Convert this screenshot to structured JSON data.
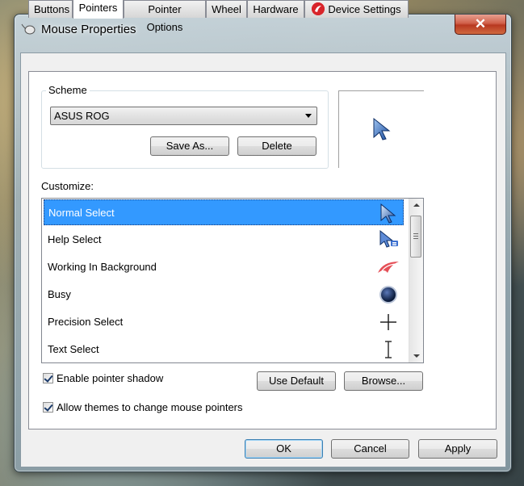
{
  "window": {
    "title": "Mouse Properties",
    "close_label": "✕"
  },
  "tabs": [
    {
      "label": "Buttons",
      "active": false
    },
    {
      "label": "Pointers",
      "active": true
    },
    {
      "label": "Pointer Options",
      "active": false
    },
    {
      "label": "Wheel",
      "active": false
    },
    {
      "label": "Hardware",
      "active": false
    },
    {
      "label": "Device Settings",
      "active": false
    }
  ],
  "scheme": {
    "group_label": "Scheme",
    "selected": "ASUS ROG",
    "save_as_label": "Save As...",
    "delete_label": "Delete"
  },
  "customize": {
    "label": "Customize:",
    "items": [
      {
        "label": "Normal Select",
        "icon": "arrow-pointer-icon",
        "selected": true
      },
      {
        "label": "Help Select",
        "icon": "help-pointer-icon",
        "selected": false
      },
      {
        "label": "Working In Background",
        "icon": "rog-logo-icon",
        "selected": false
      },
      {
        "label": "Busy",
        "icon": "busy-circle-icon",
        "selected": false
      },
      {
        "label": "Precision Select",
        "icon": "crosshair-icon",
        "selected": false
      },
      {
        "label": "Text Select",
        "icon": "ibeam-icon",
        "selected": false
      }
    ]
  },
  "options": {
    "enable_shadow_label": "Enable pointer shadow",
    "enable_shadow_checked": true,
    "allow_themes_label": "Allow themes to change mouse pointers",
    "allow_themes_checked": true,
    "use_default_label": "Use Default",
    "browse_label": "Browse..."
  },
  "footer": {
    "ok_label": "OK",
    "cancel_label": "Cancel",
    "apply_label": "Apply"
  },
  "colors": {
    "selection": "#3399ff",
    "rog_red": "#d8242a"
  }
}
